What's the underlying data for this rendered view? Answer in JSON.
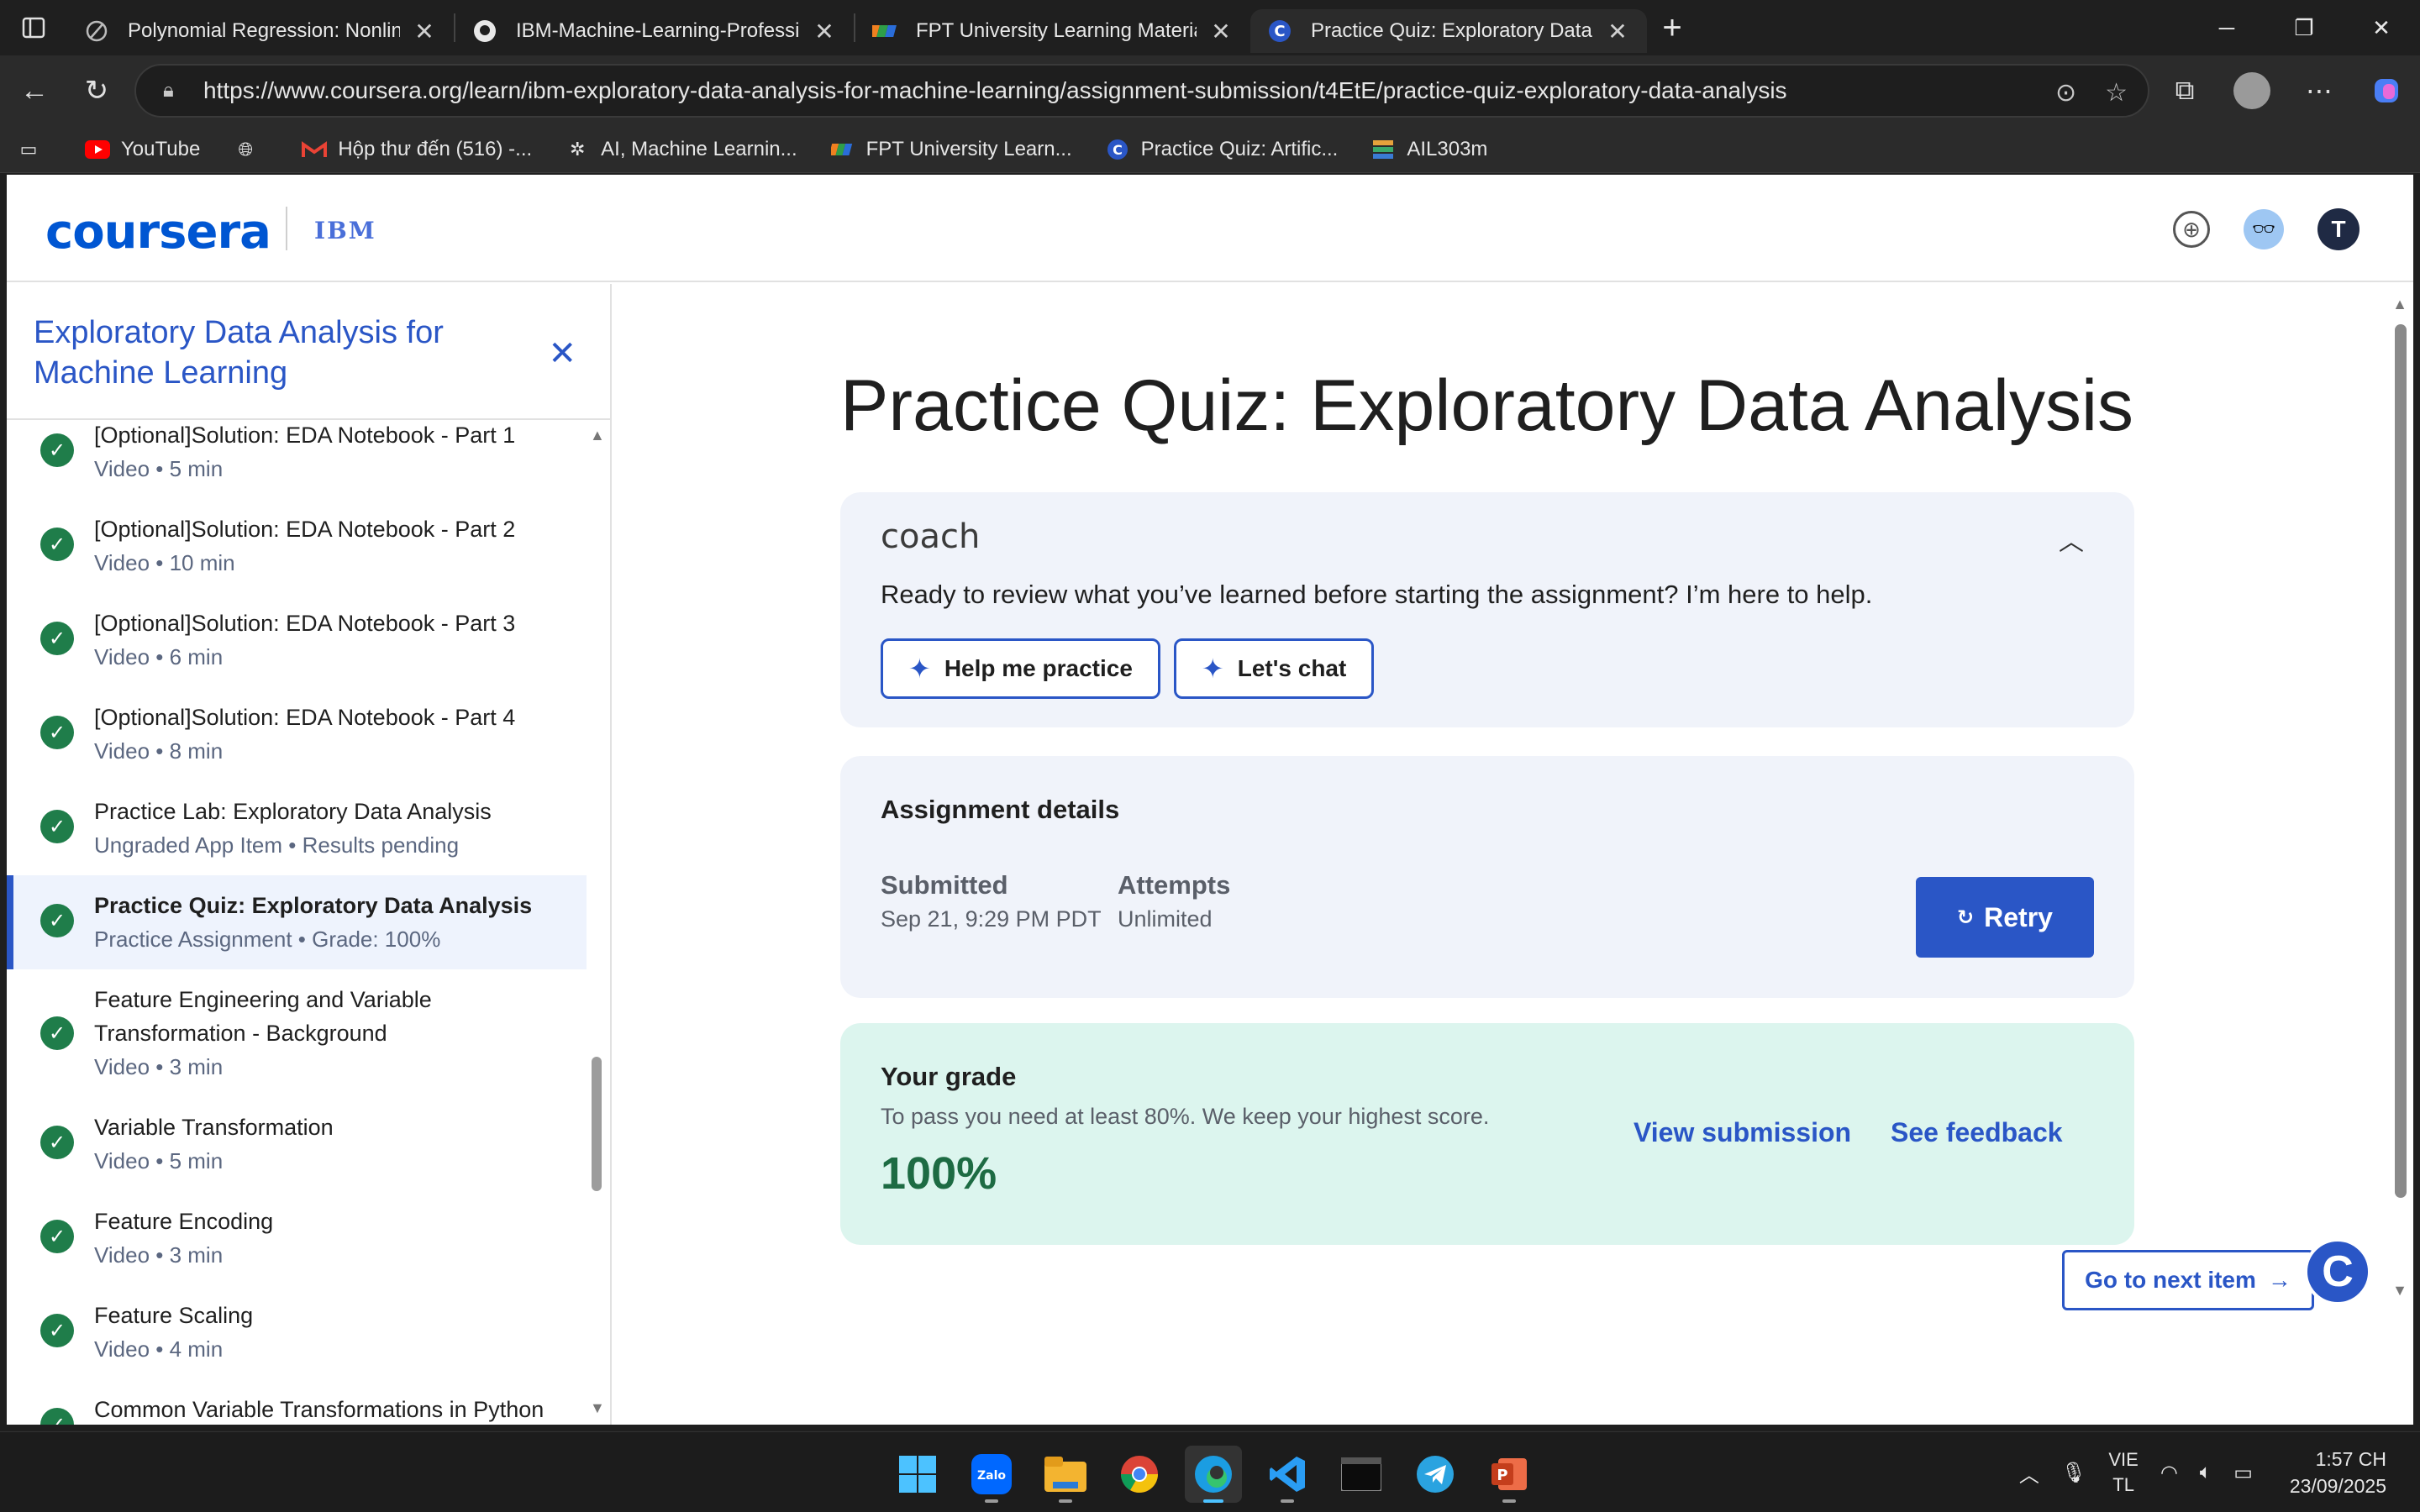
{
  "browser": {
    "tabs": [
      {
        "title": "Polynomial Regression: Nonlinear"
      },
      {
        "title": "IBM-Machine-Learning-Professior"
      },
      {
        "title": "FPT University Learning Materials"
      },
      {
        "title": "Practice Quiz: Exploratory Data An"
      }
    ],
    "url": "https://www.coursera.org/learn/ibm-exploratory-data-analysis-for-machine-learning/assignment-submission/t4EtE/practice-quiz-exploratory-data-analysis",
    "bookmarks": [
      {
        "label": "YouTube"
      },
      {
        "label": "Hộp thư đến (516) -..."
      },
      {
        "label": "AI, Machine Learnin..."
      },
      {
        "label": "FPT University Learn..."
      },
      {
        "label": "Practice Quiz: Artific..."
      },
      {
        "label": "AIL303m"
      }
    ]
  },
  "header": {
    "logo": "coursera",
    "partner": "IBM",
    "user_initial": "T"
  },
  "sidebar": {
    "title": "Exploratory Data Analysis for Machine Learning",
    "items": [
      {
        "title": "[Optional]Solution: EDA Notebook - Part 1",
        "sub": "Video • 5 min"
      },
      {
        "title": "[Optional]Solution: EDA Notebook - Part 2",
        "sub": "Video • 10 min"
      },
      {
        "title": "[Optional]Solution: EDA Notebook - Part 3",
        "sub": "Video • 6 min"
      },
      {
        "title": "[Optional]Solution: EDA Notebook - Part 4",
        "sub": "Video • 8 min"
      },
      {
        "title": "Practice Lab: Exploratory Data Analysis",
        "sub": "Ungraded App Item • Results pending"
      },
      {
        "title": "Practice Quiz: Exploratory Data Analysis",
        "sub": "Practice Assignment • Grade: 100%"
      },
      {
        "title": "Feature Engineering and Variable Transformation - Background",
        "sub": "Video • 3 min"
      },
      {
        "title": "Variable Transformation",
        "sub": "Video • 5 min"
      },
      {
        "title": "Feature Encoding",
        "sub": "Video • 3 min"
      },
      {
        "title": "Feature Scaling",
        "sub": "Video • 4 min"
      },
      {
        "title": "Common Variable Transformations in Python",
        "sub": ""
      }
    ]
  },
  "main": {
    "title": "Practice Quiz: Exploratory Data Analysis",
    "coach": {
      "logo": "coach",
      "text": "Ready to review what you’ve learned before starting the assignment? I’m here to help.",
      "btn_practice": "Help me practice",
      "btn_chat": "Let's chat"
    },
    "details": {
      "title": "Assignment details",
      "submitted_label": "Submitted",
      "submitted_value": "Sep 21, 9:29 PM PDT",
      "attempts_label": "Attempts",
      "attempts_value": "Unlimited",
      "retry": "Retry"
    },
    "grade": {
      "title": "Your grade",
      "sub": "To pass you need at least 80%. We keep your highest score.",
      "value": "100%",
      "view_submission": "View submission",
      "see_feedback": "See feedback"
    },
    "next_button": "Go to next item"
  },
  "taskbar": {
    "lang_line1": "VIE",
    "lang_line2": "TL",
    "time": "1:57 CH",
    "date": "23/09/2025"
  },
  "colors": {
    "accent": "#2a56c6",
    "success": "#1f7d4a",
    "grade_bg": "#dcf5ee",
    "card_bg": "#f0f3fa"
  }
}
